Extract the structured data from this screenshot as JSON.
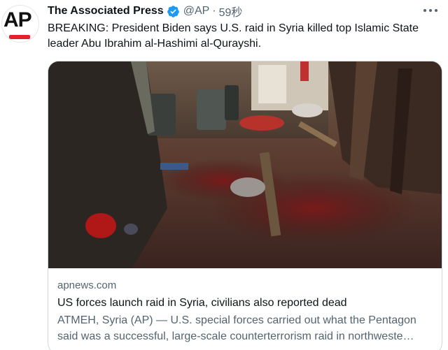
{
  "author": {
    "avatar_text": "AP",
    "display_name": "The Associated Press",
    "verified_icon": "verified-badge-icon",
    "handle": "@AP",
    "separator": "·",
    "timestamp": "59秒",
    "more_icon": "more-options-icon"
  },
  "tweet": {
    "text": "BREAKING: President Biden says U.S. raid in Syria killed top Islamic State leader Abu Ibrahim al-Hashimi al-Qurayshi."
  },
  "card": {
    "image_description_icon": "photo",
    "domain": "apnews.com",
    "title": "US forces launch raid in Syria, civilians also reported dead",
    "description": "ATMEH, Syria (AP) — U.S. special forces carried out what the Pentagon said was a successful, large-scale counterterrorism raid in northweste…"
  },
  "colors": {
    "text_primary": "#0f1419",
    "text_secondary": "#536471",
    "verified_blue": "#1d9bf0",
    "border": "#cfd9de",
    "ap_red": "#e8202c"
  }
}
